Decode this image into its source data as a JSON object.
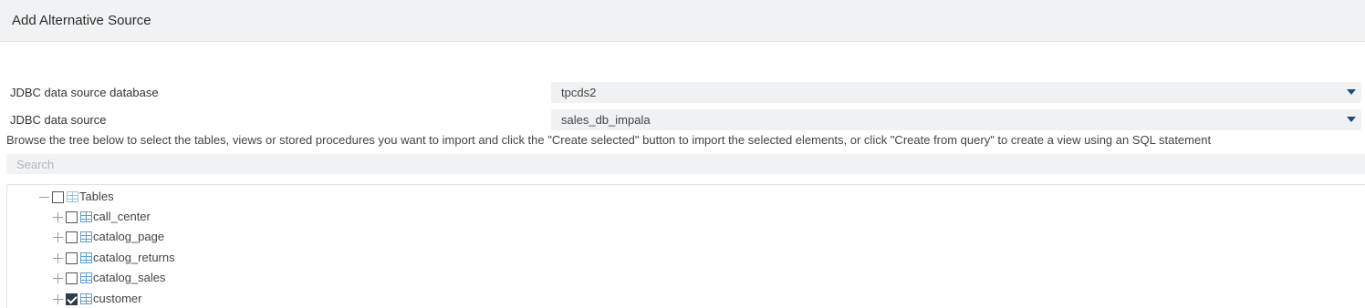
{
  "dialog": {
    "title": "Add Alternative Source"
  },
  "fields": {
    "database": {
      "label": "JDBC data source database",
      "value": "tpcds2"
    },
    "source": {
      "label": "JDBC data source",
      "value": "sales_db_impala"
    }
  },
  "help_text": "Browse the tree below to select the tables, views or stored procedures you want to import and click the \"Create selected\" button to import the selected elements, or click \"Create from query\" to create a view using an SQL statement",
  "search": {
    "placeholder": "Search",
    "value": ""
  },
  "tree": {
    "root": {
      "label": "Tables",
      "expanded": true,
      "checked": false
    },
    "items": [
      {
        "label": "call_center",
        "checked": false
      },
      {
        "label": "catalog_page",
        "checked": false
      },
      {
        "label": "catalog_returns",
        "checked": false
      },
      {
        "label": "catalog_sales",
        "checked": false
      },
      {
        "label": "customer",
        "checked": true
      }
    ]
  },
  "icons": {
    "table": "table-icon",
    "expand": "plus-icon",
    "collapse": "minus-icon",
    "dropdown": "caret-down-icon"
  },
  "colors": {
    "header_bg": "#f1f2f3",
    "field_bg": "#f0f1f2",
    "table_icon": "#5b9fd3",
    "dropdown_arrow": "#1a4d7a"
  }
}
